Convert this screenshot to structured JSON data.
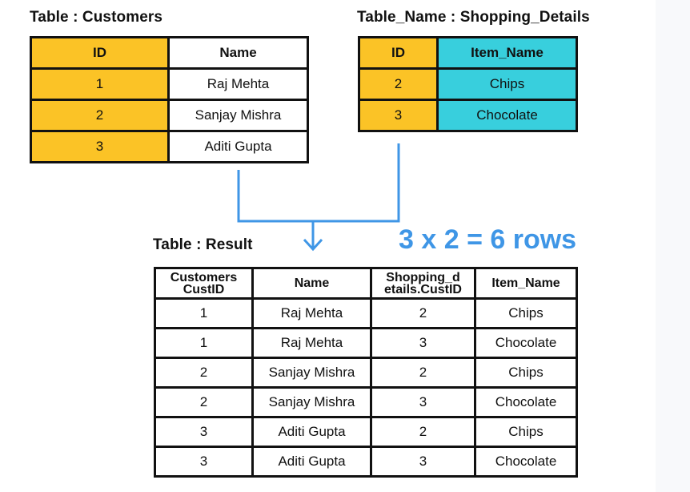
{
  "colors": {
    "id_column": "#fbc326",
    "item_column": "#38cfdd",
    "connector": "#3f96e6",
    "border": "#111111"
  },
  "customers": {
    "title": "Table : Customers",
    "headers": [
      "ID",
      "Name"
    ],
    "rows": [
      [
        "1",
        "Raj Mehta"
      ],
      [
        "2",
        "Sanjay Mishra"
      ],
      [
        "3",
        "Aditi Gupta"
      ]
    ]
  },
  "shopping": {
    "title": "Table_Name : Shopping_Details",
    "headers": [
      "ID",
      "Item_Name"
    ],
    "rows": [
      [
        "2",
        "Chips"
      ],
      [
        "3",
        "Chocolate"
      ]
    ]
  },
  "connector": {
    "arrow_icon": "arrow-down-icon",
    "formula": "3 x 2 = 6 rows"
  },
  "result": {
    "title": "Table : Result",
    "headers": [
      "Customers CustID",
      "Name",
      "Shopping_details.CustID",
      "Item_Name"
    ],
    "header_lines": [
      [
        "Customers",
        "CustID"
      ],
      [
        "Name"
      ],
      [
        "Shopping_d",
        "etails.CustID"
      ],
      [
        "Item_Name"
      ]
    ],
    "rows": [
      [
        "1",
        "Raj Mehta",
        "2",
        "Chips"
      ],
      [
        "1",
        "Raj Mehta",
        "3",
        "Chocolate"
      ],
      [
        "2",
        "Sanjay Mishra",
        "2",
        "Chips"
      ],
      [
        "2",
        "Sanjay Mishra",
        "3",
        "Chocolate"
      ],
      [
        "3",
        "Aditi Gupta",
        "2",
        "Chips"
      ],
      [
        "3",
        "Aditi Gupta",
        "3",
        "Chocolate"
      ]
    ]
  }
}
